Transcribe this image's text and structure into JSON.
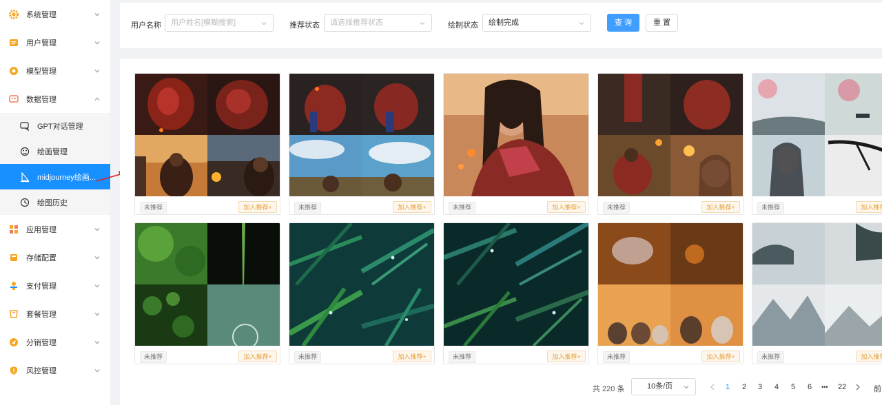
{
  "sidebar": {
    "items": [
      {
        "label": "系统管理",
        "icon": "gear-icon"
      },
      {
        "label": "用户管理",
        "icon": "user-card-icon"
      },
      {
        "label": "模型管理",
        "icon": "model-icon"
      },
      {
        "label": "数据管理",
        "icon": "data-icon"
      },
      {
        "label": "应用管理",
        "icon": "apps-icon"
      },
      {
        "label": "存储配置",
        "icon": "storage-icon"
      },
      {
        "label": "支付管理",
        "icon": "payment-icon"
      },
      {
        "label": "套餐管理",
        "icon": "package-icon"
      },
      {
        "label": "分销管理",
        "icon": "distribution-icon"
      },
      {
        "label": "风控管理",
        "icon": "shield-icon"
      }
    ],
    "sub_items": [
      {
        "label": "GPT对话管理",
        "icon": "chat-icon"
      },
      {
        "label": "绘画管理",
        "icon": "palette-icon"
      },
      {
        "label": "midjourney绘画...",
        "icon": "sail-icon"
      },
      {
        "label": "绘图历史",
        "icon": "history-icon"
      }
    ]
  },
  "filters": {
    "username_label": "用户名称",
    "username_placeholder": "用户姓名[模糊搜索]",
    "recommend_label": "推荐状态",
    "recommend_placeholder": "请选择推荐状态",
    "draw_label": "绘制状态",
    "draw_value": "绘制完成",
    "search_button": "查 询",
    "reset_button": "重 置"
  },
  "cards": {
    "status_tag": "未推荐",
    "recommend_button": "加入推荐+"
  },
  "pagination": {
    "total": "共 220 条",
    "page_size": "10条/页",
    "pages": [
      "1",
      "2",
      "3",
      "4",
      "5",
      "6"
    ],
    "ellipsis": "•••",
    "last": "22",
    "jump": "前"
  }
}
